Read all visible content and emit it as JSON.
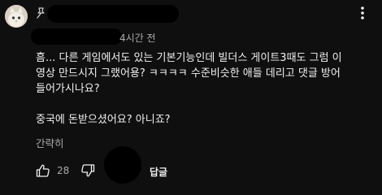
{
  "comment": {
    "timestamp": "4시간 전",
    "text_lines": [
      "흠... 다른 게임에서도 있는 기본기능인데 빌더스 게이트3때도 그럼 이",
      "영상 만드시지 그랬어용? ㅋㅋㅋㅋ 수준비슷한 애들 데리고 댓글 방어",
      "들어가시나요?"
    ],
    "text_line_2": "중국에 돈받으셨어요? 아니죠?",
    "collapse_label": "간략히",
    "like_count": "28",
    "reply_label": "답글"
  },
  "icons": {
    "avatar": "cat-avatar",
    "pin": "pin-icon",
    "menu": "more-vert-icon",
    "like": "thumb-up-icon",
    "dislike": "thumb-down-icon"
  },
  "colors": {
    "background": "#0f0f0f",
    "text": "#f1f1f1",
    "secondary_text": "#aaaaaa",
    "redaction": "#000000"
  }
}
